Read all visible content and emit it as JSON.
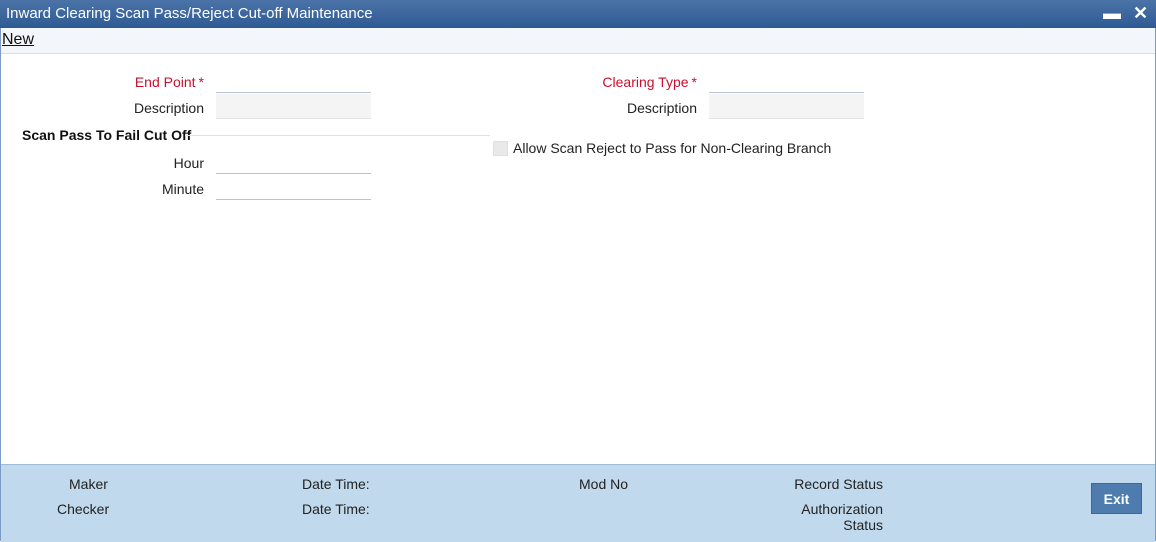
{
  "window": {
    "title": "Inward Clearing Scan Pass/Reject Cut-off Maintenance",
    "minimize_glyph": "▬",
    "close_glyph": "✕"
  },
  "menu": {
    "new_label": "New"
  },
  "form": {
    "end_point_label": "End Point",
    "end_point_value": "",
    "end_point_description_label": "Description",
    "end_point_description_value": "",
    "clearing_type_label": "Clearing Type",
    "clearing_type_value": "",
    "clearing_type_description_label": "Description",
    "clearing_type_description_value": "",
    "required_marker": "*",
    "section_title": "Scan Pass To Fail Cut Off",
    "hour_label": "Hour",
    "hour_value": "",
    "minute_label": "Minute",
    "minute_value": "",
    "allow_scan_reject_label": "Allow Scan Reject to Pass for Non-Clearing Branch",
    "allow_scan_reject_checked": false
  },
  "footer": {
    "maker_label": "Maker",
    "checker_label": "Checker",
    "maker_datetime_label": "Date Time:",
    "checker_datetime_label": "Date Time:",
    "mod_no_label": "Mod No",
    "record_status_label": "Record Status",
    "authorization_label": "Authorization",
    "authorization_status_label": "Status",
    "exit_label": "Exit"
  },
  "colors": {
    "titlebar": "#3a65a0",
    "required_text": "#c8102e",
    "footer_bg": "#c1d9ec",
    "exit_button": "#4e7cae"
  }
}
